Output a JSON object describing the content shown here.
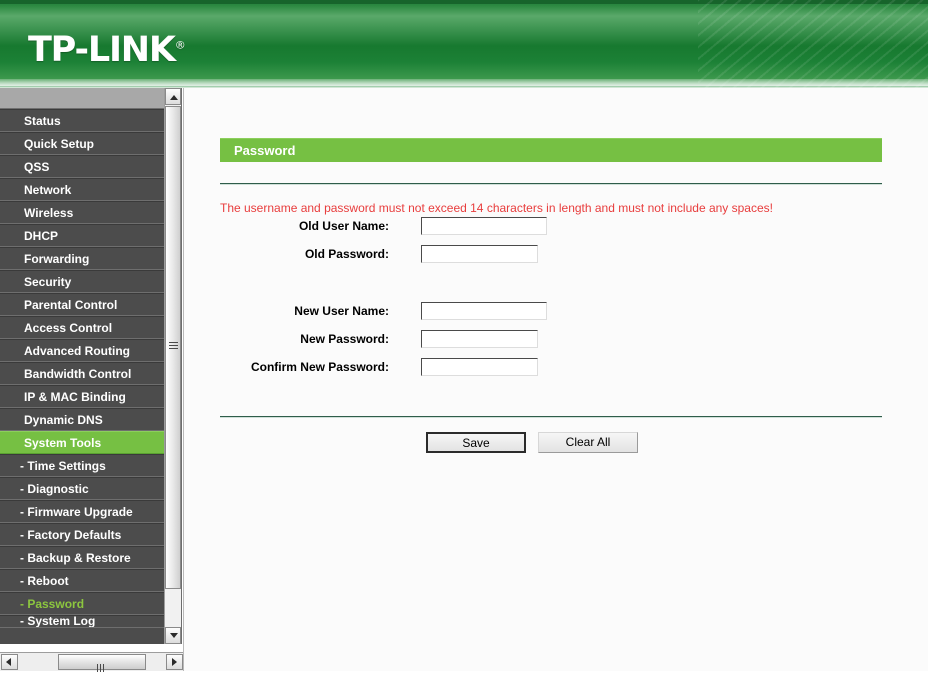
{
  "brand": {
    "name": "TP-LINK",
    "registered_mark": "®"
  },
  "sidebar": {
    "items": [
      {
        "label": "Status",
        "type": "main",
        "state": "normal"
      },
      {
        "label": "Quick Setup",
        "type": "main",
        "state": "normal"
      },
      {
        "label": "QSS",
        "type": "main",
        "state": "normal"
      },
      {
        "label": "Network",
        "type": "main",
        "state": "normal"
      },
      {
        "label": "Wireless",
        "type": "main",
        "state": "normal"
      },
      {
        "label": "DHCP",
        "type": "main",
        "state": "normal"
      },
      {
        "label": "Forwarding",
        "type": "main",
        "state": "normal"
      },
      {
        "label": "Security",
        "type": "main",
        "state": "normal"
      },
      {
        "label": "Parental Control",
        "type": "main",
        "state": "normal"
      },
      {
        "label": "Access Control",
        "type": "main",
        "state": "normal"
      },
      {
        "label": "Advanced Routing",
        "type": "main",
        "state": "normal"
      },
      {
        "label": "Bandwidth Control",
        "type": "main",
        "state": "normal"
      },
      {
        "label": "IP & MAC Binding",
        "type": "main",
        "state": "normal"
      },
      {
        "label": "Dynamic DNS",
        "type": "main",
        "state": "normal"
      },
      {
        "label": "System Tools",
        "type": "main",
        "state": "active"
      },
      {
        "label": "- Time Settings",
        "type": "sub",
        "state": "normal"
      },
      {
        "label": "- Diagnostic",
        "type": "sub",
        "state": "normal"
      },
      {
        "label": "- Firmware Upgrade",
        "type": "sub",
        "state": "normal"
      },
      {
        "label": "- Factory Defaults",
        "type": "sub",
        "state": "normal"
      },
      {
        "label": "- Backup & Restore",
        "type": "sub",
        "state": "normal"
      },
      {
        "label": "- Reboot",
        "type": "sub",
        "state": "normal"
      },
      {
        "label": "- Password",
        "type": "sub",
        "state": "current"
      },
      {
        "label": "- System Log",
        "type": "sub",
        "state": "clipped"
      }
    ]
  },
  "main": {
    "panel_title": "Password",
    "warning": "The username and password must not exceed 14 characters in length and must not include any spaces!",
    "fields": [
      {
        "label": "Old User Name:",
        "value": "",
        "width": "wide"
      },
      {
        "label": "Old Password:",
        "value": "",
        "width": "narrow"
      },
      {
        "label": "New User Name:",
        "value": "",
        "width": "wide"
      },
      {
        "label": "New Password:",
        "value": "",
        "width": "narrow"
      },
      {
        "label": "Confirm New Password:",
        "value": "",
        "width": "narrow"
      }
    ],
    "buttons": {
      "save": "Save",
      "clear_all": "Clear All"
    }
  },
  "colors": {
    "brand_green": "#76c043",
    "header_green": "#1c8136",
    "warning_red": "#e83d3d",
    "sidebar_gray": "#4c4c4c"
  }
}
